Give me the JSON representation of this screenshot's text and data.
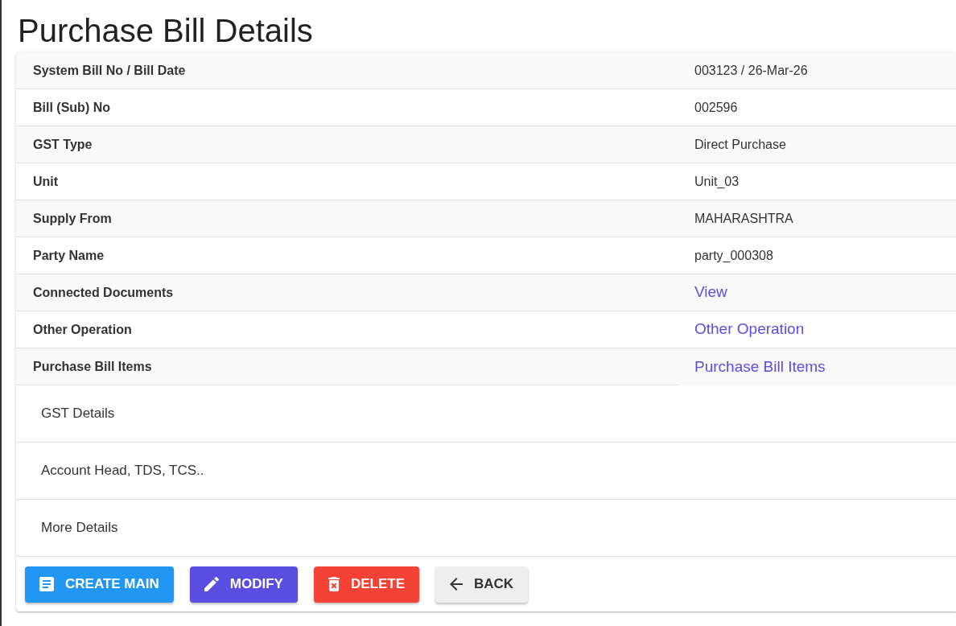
{
  "title": "Purchase Bill Details",
  "details": [
    {
      "label": "System Bill No / Bill Date",
      "value": "003123 / 26-Mar-26",
      "kind": "text"
    },
    {
      "label": "Bill (Sub) No",
      "value": "002596",
      "kind": "text"
    },
    {
      "label": "GST Type",
      "value": "Direct Purchase",
      "kind": "text"
    },
    {
      "label": "Unit",
      "value": "Unit_03",
      "kind": "text"
    },
    {
      "label": "Supply From",
      "value": "MAHARASHTRA",
      "kind": "text"
    },
    {
      "label": "Party Name",
      "value": "party_000308",
      "kind": "text"
    },
    {
      "label": "Connected Documents",
      "value": "View",
      "kind": "link"
    },
    {
      "label": "Other Operation",
      "value": "Other Operation",
      "kind": "link"
    },
    {
      "label": "Purchase Bill Items",
      "value": "Purchase Bill Items",
      "kind": "link"
    }
  ],
  "sections": [
    "GST Details",
    "Account Head, TDS, TCS..",
    "More Details"
  ],
  "actions": [
    {
      "label": "CREATE MAIN",
      "kind": "create"
    },
    {
      "label": "MODIFY",
      "kind": "modify"
    },
    {
      "label": "DELETE",
      "kind": "delete"
    },
    {
      "label": "BACK",
      "kind": "back"
    }
  ]
}
